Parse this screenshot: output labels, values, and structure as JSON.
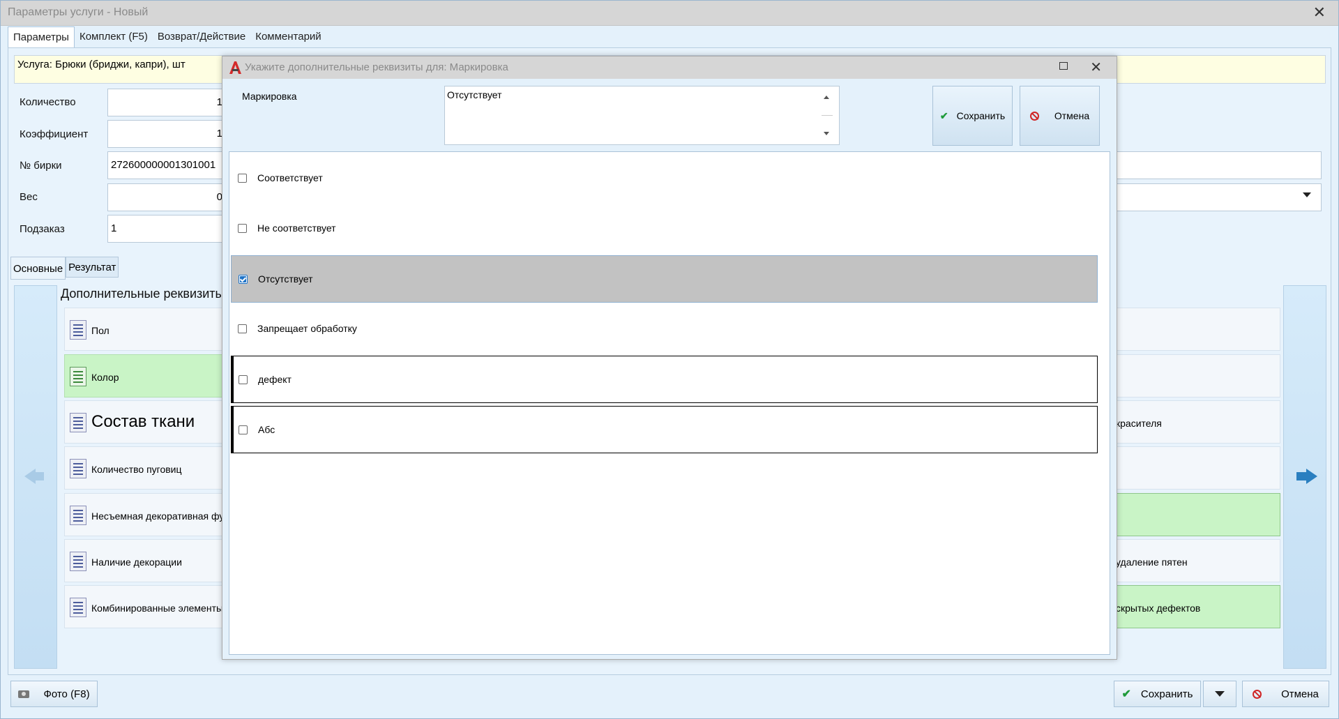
{
  "window": {
    "title": "Параметры услуги - Новый",
    "close": "✕"
  },
  "tabs": [
    {
      "label": "Параметры"
    },
    {
      "label": "Комплект (F5)"
    },
    {
      "label": "Возврат/Действие"
    },
    {
      "label": "Комментарий"
    }
  ],
  "service": {
    "text": "Услуга: Брюки (бриджи, капри), шт"
  },
  "params": {
    "quantity": {
      "label": "Количество",
      "value": "1"
    },
    "coefficient": {
      "label": "Коэффициент",
      "value": "1"
    },
    "tag": {
      "label": "№ бирки",
      "value": "272600000001301001"
    },
    "weight": {
      "label": "Вес",
      "value": "0"
    },
    "suborder": {
      "label": "Подзаказ",
      "value": "1"
    }
  },
  "subtabs": [
    {
      "label": "Основные"
    },
    {
      "label": "Результат"
    }
  ],
  "attributes": {
    "heading": "Дополнительные реквизиты",
    "left": [
      {
        "label": "Пол",
        "green": false
      },
      {
        "label": "Колор",
        "green": true
      },
      {
        "label": "Состав ткани",
        "green": false
      },
      {
        "label": "Количество пуговиц",
        "green": false
      },
      {
        "label": "Несъемная декоративная фурнитура",
        "green": false
      },
      {
        "label": "Наличие декорации",
        "green": false
      },
      {
        "label": "Комбинированные элементы",
        "green": false
      }
    ],
    "right": [
      {
        "label": "",
        "green": false
      },
      {
        "label": "",
        "green": false
      },
      {
        "label": "красителя",
        "green": false
      },
      {
        "label": "",
        "green": false
      },
      {
        "label": "",
        "green": true
      },
      {
        "label": "удаление пятен",
        "green": false
      },
      {
        "label": "скрытых дефектов",
        "green": true
      }
    ]
  },
  "footer": {
    "photo_label": "Фото (F8)",
    "save_label": "Сохранить",
    "cancel_label": "Отмена"
  },
  "dialog": {
    "title": "Укажите дополнительные реквизиты для: Маркировка",
    "field_label": "Маркировка",
    "field_value": "Отсутствует",
    "save_label": "Сохранить",
    "cancel_label": "Отмена",
    "options": [
      {
        "label": "Соответствует",
        "checked": false
      },
      {
        "label": "Не соответствует",
        "checked": false
      },
      {
        "label": "Отсутствует",
        "checked": true
      },
      {
        "label": "Запрещает обработку",
        "checked": false
      },
      {
        "label": "дефект",
        "checked": false
      },
      {
        "label": "Абс",
        "checked": false
      }
    ]
  },
  "colors": {
    "accent": "#2a7fc0",
    "green_item": "#c9f4c6",
    "selected_row": "#c2c2c2",
    "service_bar": "#fefee2",
    "check_green": "#1f9a3a",
    "cancel_red": "#d02525"
  }
}
